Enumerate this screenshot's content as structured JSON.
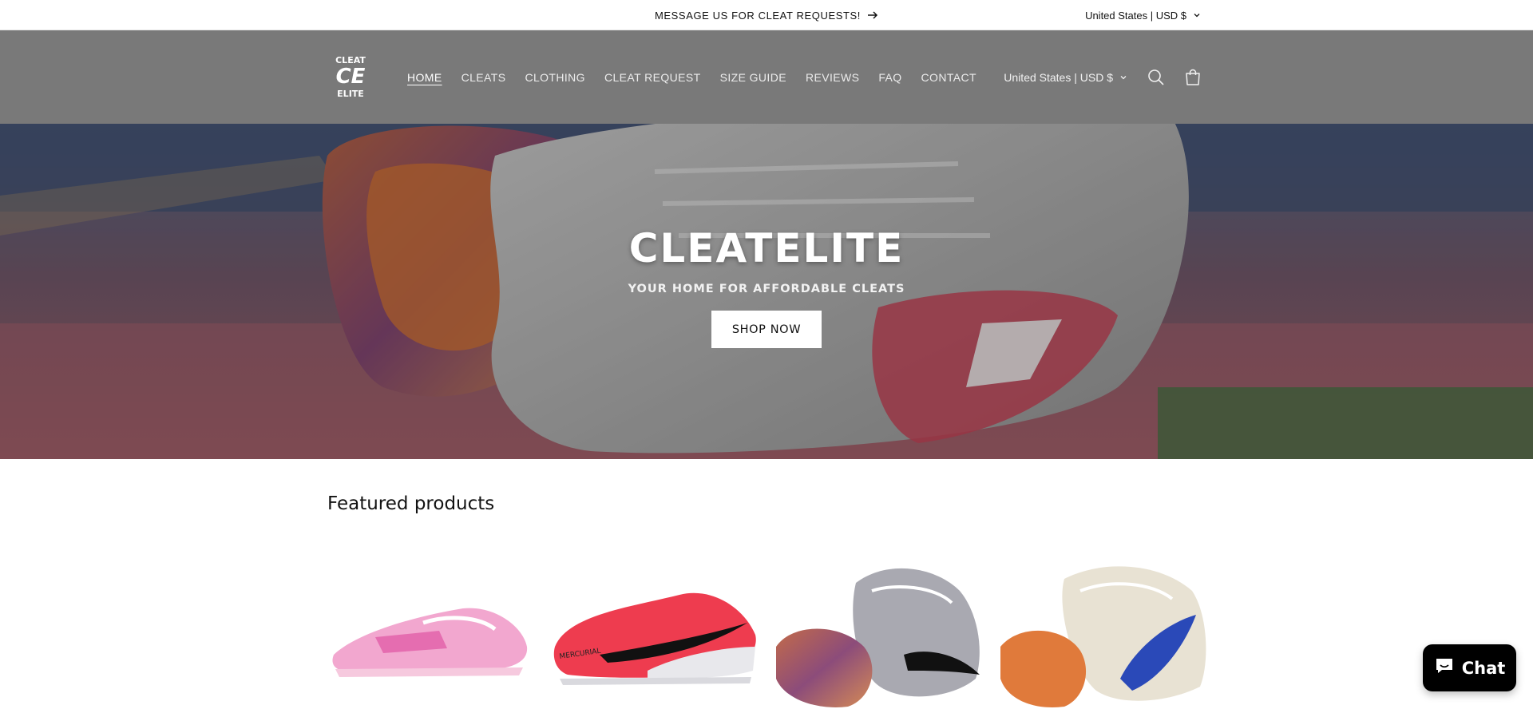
{
  "announcement": {
    "text": "MESSAGE US FOR CLEAT REQUESTS!",
    "arrow_icon": "arrow-right-icon",
    "country": "United States | USD $"
  },
  "header": {
    "logo": {
      "line1": "CLEAT",
      "line2": "CE",
      "line3": "ELITE"
    },
    "nav": [
      {
        "label": "HOME",
        "active": true
      },
      {
        "label": "CLEATS",
        "active": false
      },
      {
        "label": "CLOTHING",
        "active": false
      },
      {
        "label": "CLEAT REQUEST",
        "active": false
      },
      {
        "label": "SIZE GUIDE",
        "active": false
      },
      {
        "label": "REVIEWS",
        "active": false
      },
      {
        "label": "FAQ",
        "active": false
      },
      {
        "label": "CONTACT",
        "active": false
      }
    ],
    "country": "United States | USD $",
    "icons": [
      "search-icon",
      "cart-icon",
      "chevron-down-icon"
    ]
  },
  "hero": {
    "title": "CLEATELITE",
    "subtitle": "YOUR HOME FOR AFFORDABLE CLEATS",
    "button": "SHOP NOW"
  },
  "featured": {
    "title": "Featured products",
    "products": [
      {
        "image": "pink adidas cleat"
      },
      {
        "image": "red Nike Mercurial cleat",
        "print": "MERCURIAL"
      },
      {
        "image": "grey Nike cleats pair"
      },
      {
        "image": "white and blue Nike cleats pair"
      }
    ]
  },
  "chat": {
    "label": "Chat",
    "icon": "chat-bubble-icon"
  },
  "colors": {
    "header_bg": "#797979",
    "chat_bg": "#000000",
    "text": "#121212"
  }
}
